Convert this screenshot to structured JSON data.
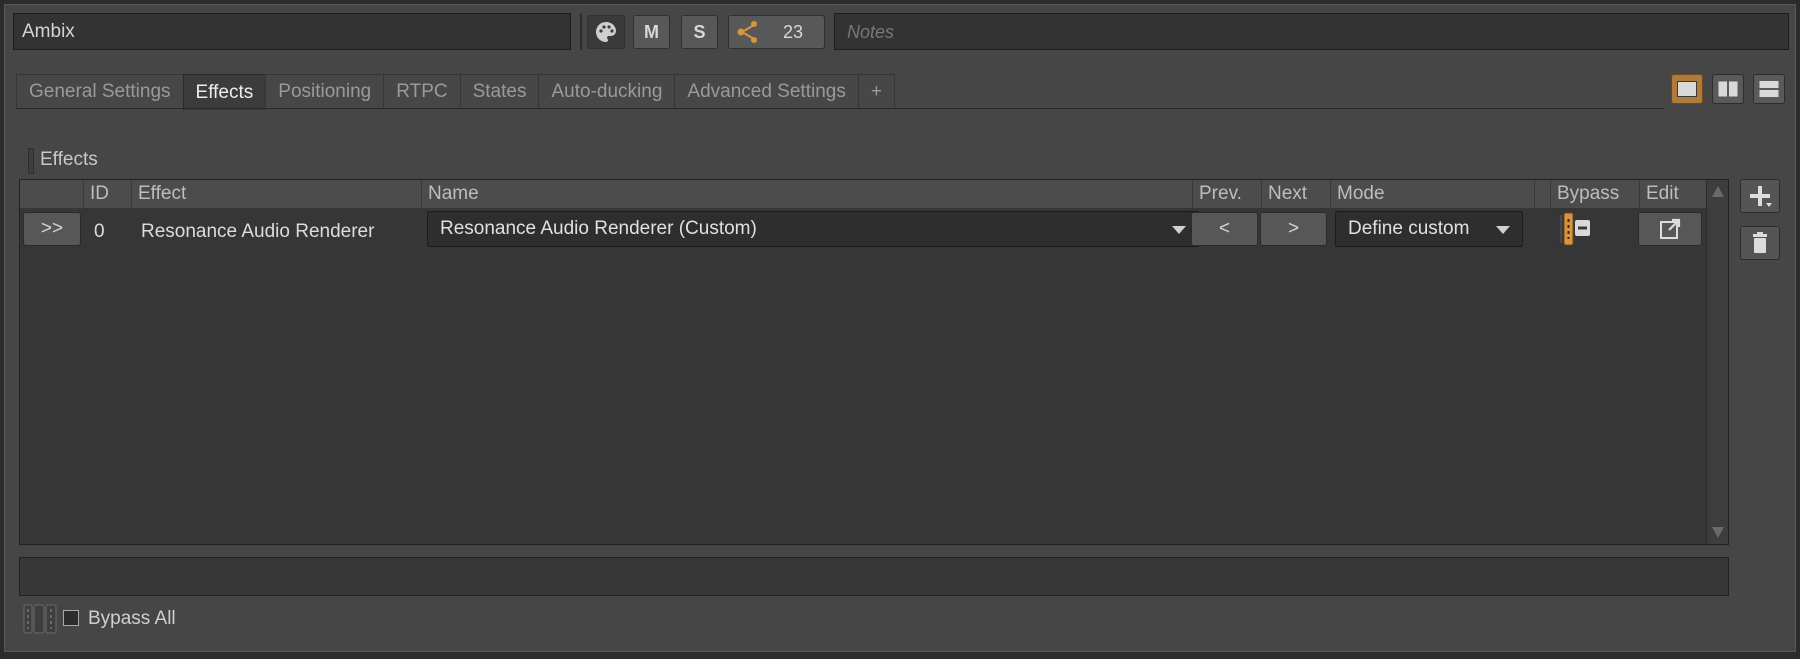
{
  "header": {
    "object_name": "Ambix",
    "mute_label": "M",
    "solo_label": "S",
    "reference_count": "23",
    "notes_placeholder": "Notes"
  },
  "tabs": [
    {
      "label": "General Settings",
      "active": false
    },
    {
      "label": "Effects",
      "active": true
    },
    {
      "label": "Positioning",
      "active": false
    },
    {
      "label": "RTPC",
      "active": false
    },
    {
      "label": "States",
      "active": false
    },
    {
      "label": "Auto-ducking",
      "active": false
    },
    {
      "label": "Advanced Settings",
      "active": false
    },
    {
      "label": "+",
      "active": false
    }
  ],
  "section": {
    "title": "Effects"
  },
  "table": {
    "columns": [
      "ID",
      "Effect",
      "Name",
      "Prev.",
      "Next",
      "Mode",
      "Bypass",
      "Edit"
    ],
    "rows": [
      {
        "expand_label": ">>",
        "id": "0",
        "effect": "Resonance Audio Renderer",
        "name": "Resonance Audio Renderer (Custom)",
        "prev_label": "<",
        "next_label": ">",
        "mode": "Define custom"
      }
    ]
  },
  "footer": {
    "bypass_all_label": "Bypass All",
    "bypass_all_checked": false
  },
  "colors": {
    "accent": "#d7953f",
    "background": "#464646",
    "grid": "#363636"
  }
}
